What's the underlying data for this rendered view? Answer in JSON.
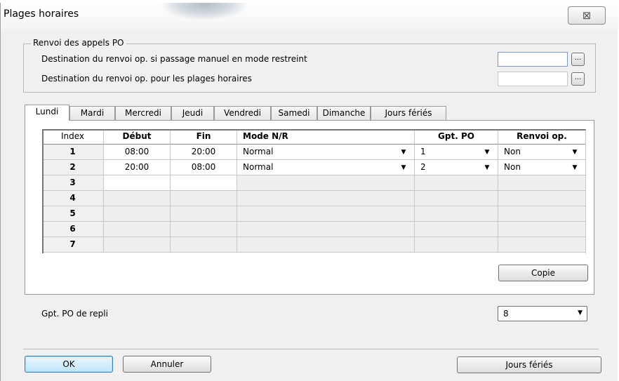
{
  "window": {
    "title": "Plages horaires",
    "close_symbol": "⊠"
  },
  "renvoi_group": {
    "legend": "Renvoi des appels PO",
    "rows": [
      {
        "label": "Destination du renvoi op. si passage manuel en mode restreint",
        "value": "",
        "browse": "..."
      },
      {
        "label": "Destination du renvoi op. pour les plages horaires",
        "value": "",
        "browse": "..."
      }
    ]
  },
  "tabs": [
    "Lundi",
    "Mardi",
    "Mercredi",
    "Jeudi",
    "Vendredi",
    "Samedi",
    "Dimanche",
    "Jours fériés"
  ],
  "active_tab": "Lundi",
  "table": {
    "columns": [
      "Index",
      "Début",
      "Fin",
      "Mode N/R",
      "Gpt. PO",
      "Renvoi op."
    ],
    "rows": [
      {
        "index": "1",
        "debut": "08:00",
        "fin": "20:00",
        "mode": "Normal",
        "gpt": "1",
        "renvoi": "Non"
      },
      {
        "index": "2",
        "debut": "20:00",
        "fin": "08:00",
        "mode": "Normal",
        "gpt": "2",
        "renvoi": "Non"
      },
      {
        "index": "3",
        "debut": "",
        "fin": "",
        "mode": "",
        "gpt": "",
        "renvoi": ""
      },
      {
        "index": "4",
        "debut": "",
        "fin": "",
        "mode": "",
        "gpt": "",
        "renvoi": ""
      },
      {
        "index": "5",
        "debut": "",
        "fin": "",
        "mode": "",
        "gpt": "",
        "renvoi": ""
      },
      {
        "index": "6",
        "debut": "",
        "fin": "",
        "mode": "",
        "gpt": "",
        "renvoi": ""
      },
      {
        "index": "7",
        "debut": "",
        "fin": "",
        "mode": "",
        "gpt": "",
        "renvoi": ""
      }
    ],
    "dropdown_arrow": "▼"
  },
  "buttons": {
    "copie": "Copie",
    "ok": "OK",
    "annuler": "Annuler",
    "jours_feries": "Jours fériés"
  },
  "fallback": {
    "label": "Gpt. PO de repli",
    "value": "8",
    "arrow": "▼"
  },
  "colors": {
    "focus_border": "#3c7fb1",
    "window_bg": "#f0f0f0"
  }
}
